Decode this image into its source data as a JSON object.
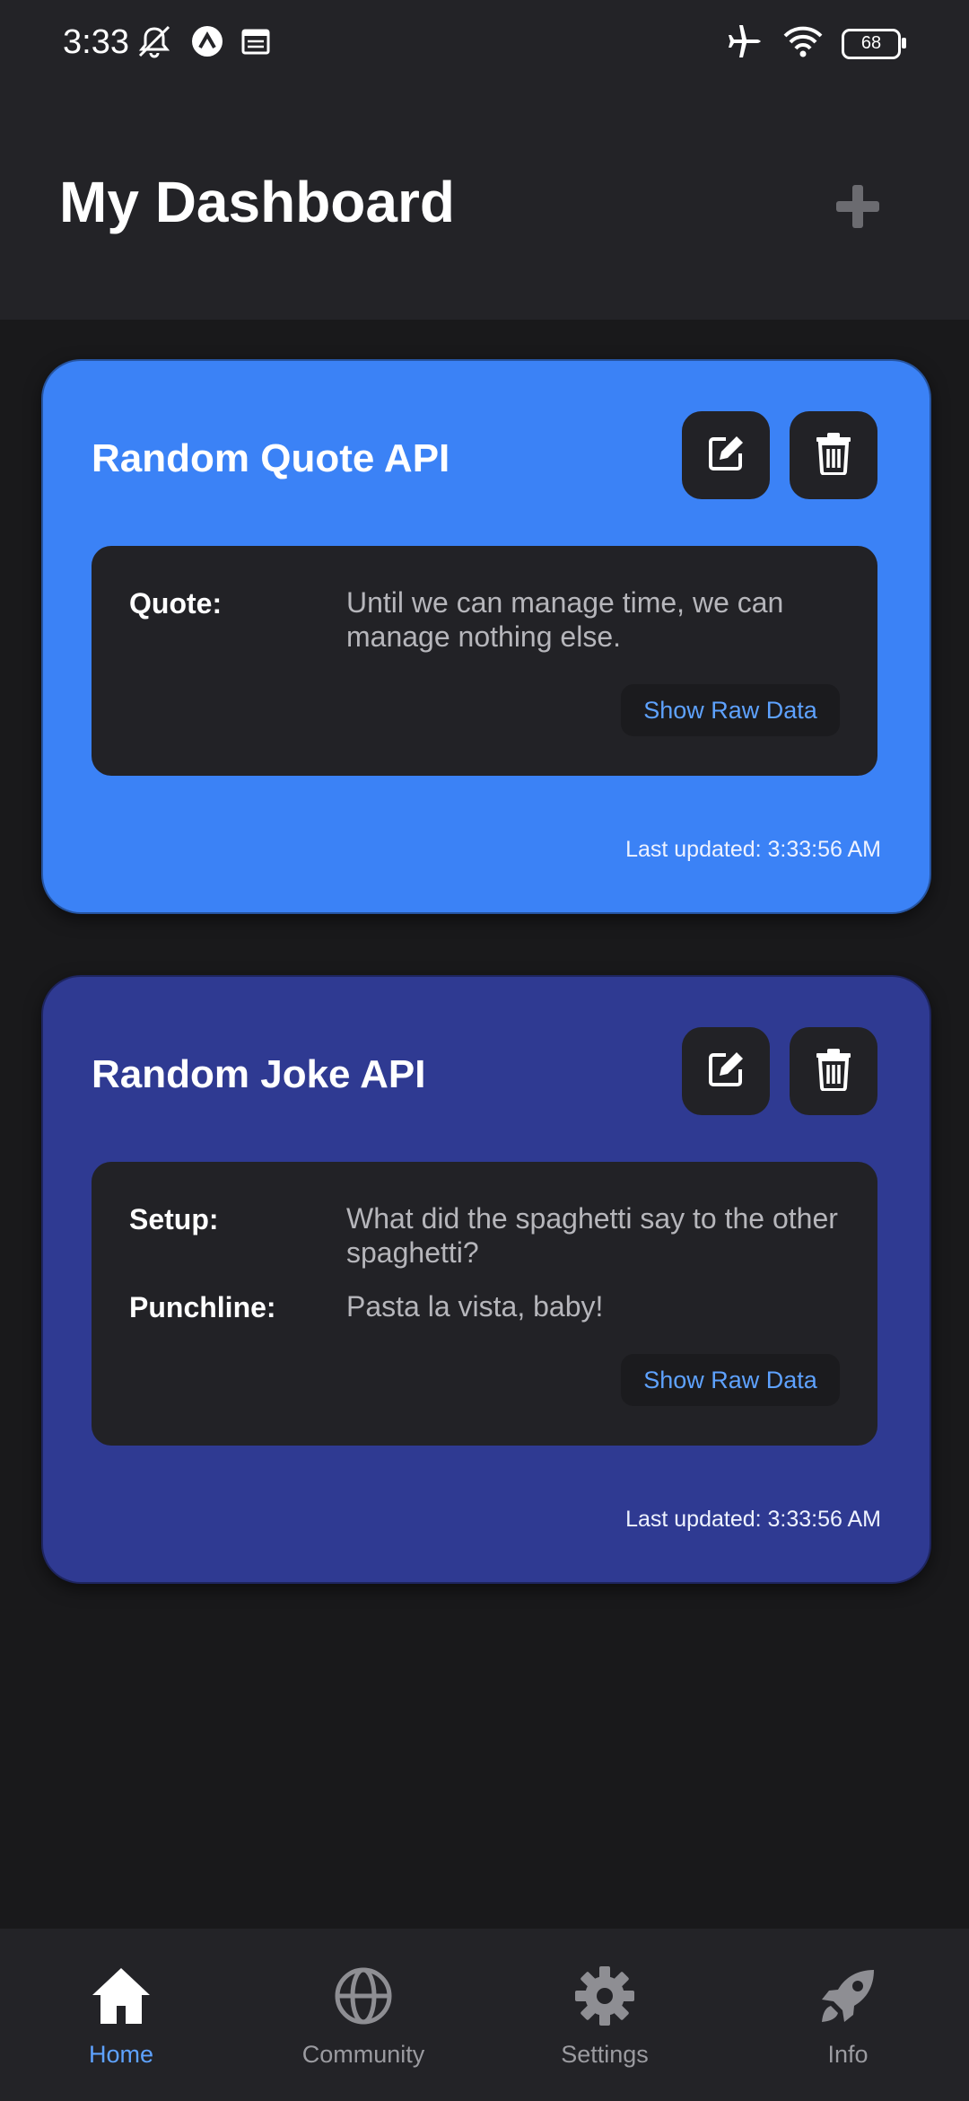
{
  "status_bar": {
    "time": "3:33",
    "battery": "68",
    "icons_left": [
      "mute-icon",
      "app-icon",
      "calendar-icon"
    ],
    "icons_right": [
      "airplane-icon",
      "wifi-icon",
      "battery-icon"
    ]
  },
  "header": {
    "title": "My Dashboard",
    "add_icon": "plus-icon"
  },
  "cards": [
    {
      "title": "Random Quote API",
      "color": "#3b82f6",
      "fields": [
        {
          "label": "Quote:",
          "value": "Until we can manage time, we can manage nothing else."
        }
      ],
      "raw_button": "Show Raw Data",
      "updated": "Last updated: 3:33:56 AM"
    },
    {
      "title": "Random Joke API",
      "color": "#2f3a92",
      "fields": [
        {
          "label": "Setup:",
          "value": "What did the spaghetti say to the other spaghetti?"
        },
        {
          "label": "Punchline:",
          "value": "Pasta la vista, baby!"
        }
      ],
      "raw_button": "Show Raw Data",
      "updated": "Last updated: 3:33:56 AM"
    }
  ],
  "nav": {
    "items": [
      {
        "label": "Home",
        "icon": "home-icon",
        "active": true
      },
      {
        "label": "Community",
        "icon": "globe-icon",
        "active": false
      },
      {
        "label": "Settings",
        "icon": "gear-icon",
        "active": false
      },
      {
        "label": "Info",
        "icon": "rocket-icon",
        "active": false
      }
    ],
    "active_color": "#5ea2ff"
  }
}
